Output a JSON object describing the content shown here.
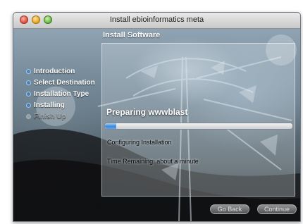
{
  "window": {
    "title": "Install ebioinformatics meta"
  },
  "header": {
    "title": "Install Software"
  },
  "sidebar": {
    "steps": [
      {
        "label": "Introduction",
        "state": "done"
      },
      {
        "label": "Select Destination",
        "state": "done"
      },
      {
        "label": "Installation Type",
        "state": "done"
      },
      {
        "label": "Installing",
        "state": "current"
      },
      {
        "label": "Finish Up",
        "state": "pending"
      }
    ]
  },
  "main": {
    "status": "Preparing wwwblast",
    "detail": "Configuring Installation",
    "time_remaining": "Time Remaining: about a minute",
    "progress_percent": 6
  },
  "buttons": {
    "back_label": "Go Back",
    "continue_label": "Continue"
  },
  "colors": {
    "progress_accent": "#3a87da",
    "close": "#d94b38",
    "minimize": "#e3a214",
    "zoom": "#5fb23a"
  }
}
